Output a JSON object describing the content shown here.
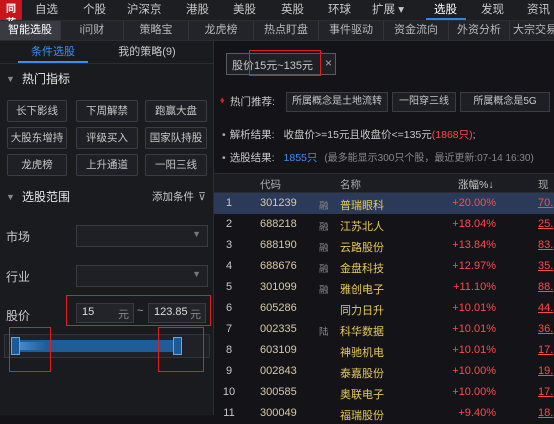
{
  "topnav": {
    "logo_glyph": "同花",
    "items": [
      "自选",
      "个股",
      "沪深京",
      "港股",
      "美股",
      "英股",
      "环球",
      "扩展 ▾",
      "选股",
      "发现",
      "资讯"
    ]
  },
  "subnav": {
    "items": [
      "智能选股",
      "i问财",
      "策略宝",
      "龙虎榜",
      "热点盯盘",
      "事件驱动",
      "资金流向",
      "外资分析",
      "大宗交易"
    ]
  },
  "left": {
    "tabs": [
      "条件选股",
      "我的策略(9)"
    ],
    "hot_title": "热门指标",
    "hot_buttons": [
      "长下影线",
      "下周解禁",
      "跑赢大盘",
      "大股东增持",
      "评级买入",
      "国家队持股",
      "龙虎榜",
      "上升通道",
      "一阳三线"
    ],
    "range_title": "选股范围",
    "add_condition": "添加条件",
    "market_label": "市场",
    "industry_label": "行业",
    "price_label": "股价",
    "price_min": "15",
    "price_max": "123.85",
    "price_unit": "元",
    "range_sep": "~"
  },
  "right": {
    "condition_chip_prefix": "股价",
    "condition_chip_range": "15元~135元",
    "close_glyph": "×",
    "hot_label": "热门推荐:",
    "hot_buttons": [
      "所属概念是土地流转",
      "一阳穿三线",
      "所属概念是5G"
    ],
    "parse_label": "解析结果:",
    "parse_text": "收盘价>=15元且收盘价<=135元",
    "parse_count": "(1868只)",
    "parse_tail": ";",
    "result_label": "选股结果:",
    "result_count": "1855只",
    "result_note": "(最多能显示300只个股，最近更新:07-14 16:30)",
    "headers": {
      "code": "代码",
      "name": "名称",
      "change": "涨幅%↓",
      "price": "现"
    }
  },
  "table_rows": [
    {
      "idx": "1",
      "code": "301239",
      "tag": "融",
      "name": "普瑞眼科",
      "change": "+20.00%",
      "price": "70."
    },
    {
      "idx": "2",
      "code": "688218",
      "tag": "融",
      "name": "江苏北人",
      "change": "+18.04%",
      "price": "25."
    },
    {
      "idx": "3",
      "code": "688190",
      "tag": "融",
      "name": "云路股份",
      "change": "+13.84%",
      "price": "83."
    },
    {
      "idx": "4",
      "code": "688676",
      "tag": "融",
      "name": "金盘科技",
      "change": "+12.97%",
      "price": "35."
    },
    {
      "idx": "5",
      "code": "301099",
      "tag": "融",
      "name": "雅创电子",
      "change": "+11.10%",
      "price": "88."
    },
    {
      "idx": "6",
      "code": "605286",
      "tag": "",
      "name": "同力日升",
      "change": "+10.01%",
      "price": "44."
    },
    {
      "idx": "7",
      "code": "002335",
      "tag": "陆",
      "name": "科华数据",
      "change": "+10.01%",
      "price": "36."
    },
    {
      "idx": "8",
      "code": "603109",
      "tag": "",
      "name": "神驰机电",
      "change": "+10.01%",
      "price": "17."
    },
    {
      "idx": "9",
      "code": "002843",
      "tag": "",
      "name": "泰嘉股份",
      "change": "+10.00%",
      "price": "19."
    },
    {
      "idx": "10",
      "code": "300585",
      "tag": "",
      "name": "奥联电子",
      "change": "+10.00%",
      "price": "17."
    },
    {
      "idx": "11",
      "code": "300049",
      "tag": "",
      "name": "福瑞股份",
      "change": "+9.40%",
      "price": "18."
    }
  ],
  "colors": {
    "accent": "#3d8ef0",
    "up": "#ff4a4a",
    "highlight": "#e02020",
    "name": "#e6c95a"
  }
}
